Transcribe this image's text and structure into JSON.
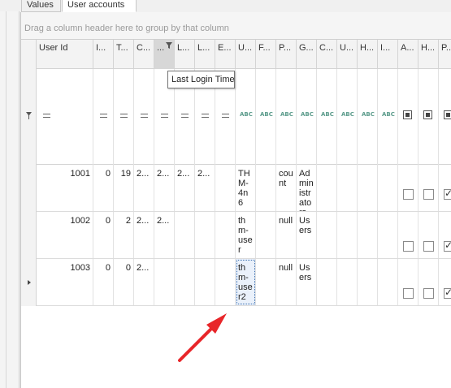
{
  "tabs": [
    {
      "label": "Values"
    },
    {
      "label": "User accounts"
    }
  ],
  "group_panel": {
    "hint": "Drag a column header here to group by that column"
  },
  "columns": [
    {
      "label": "User Id"
    },
    {
      "label": "I..."
    },
    {
      "label": "T..."
    },
    {
      "label": "C..."
    },
    {
      "label": "..."
    },
    {
      "label": "L..."
    },
    {
      "label": "L..."
    },
    {
      "label": "E..."
    },
    {
      "label": "U..."
    },
    {
      "label": "F..."
    },
    {
      "label": "P..."
    },
    {
      "label": "G..."
    },
    {
      "label": "C..."
    },
    {
      "label": "U..."
    },
    {
      "label": "H..."
    },
    {
      "label": "I..."
    },
    {
      "label": "A..."
    },
    {
      "label": "H..."
    },
    {
      "label": "P..."
    }
  ],
  "tooltip": {
    "text": "Last Login Time"
  },
  "filter_text_icon": "abc-icon",
  "rows": [
    {
      "user_id": "1001",
      "c1": "0",
      "c2": "19",
      "c3": "2...",
      "c4": "2...",
      "c5": "2...",
      "c6": "2...",
      "username": "TH\nM-\n4n\n6",
      "p": "cou\nnt",
      "group": "Ad\nmin\nistr\nato\nrs",
      "flag_a": false,
      "flag_h": false,
      "flag_p": true
    },
    {
      "user_id": "1002",
      "c1": "0",
      "c2": "2",
      "c3": "2...",
      "c4": "2...",
      "c5": "",
      "c6": "",
      "username": "th\nm-\nuse\nr",
      "p": "null",
      "group": "Us\ners",
      "flag_a": false,
      "flag_h": false,
      "flag_p": true
    },
    {
      "user_id": "1003",
      "c1": "0",
      "c2": "0",
      "c3": "2...",
      "c4": "",
      "c5": "",
      "c6": "",
      "username": "th\nm-\nuse\nr2",
      "p": "null",
      "group": "Us\ners",
      "flag_a": false,
      "flag_h": false,
      "flag_p": true
    }
  ],
  "annotation": {
    "color": "#e8262a"
  }
}
